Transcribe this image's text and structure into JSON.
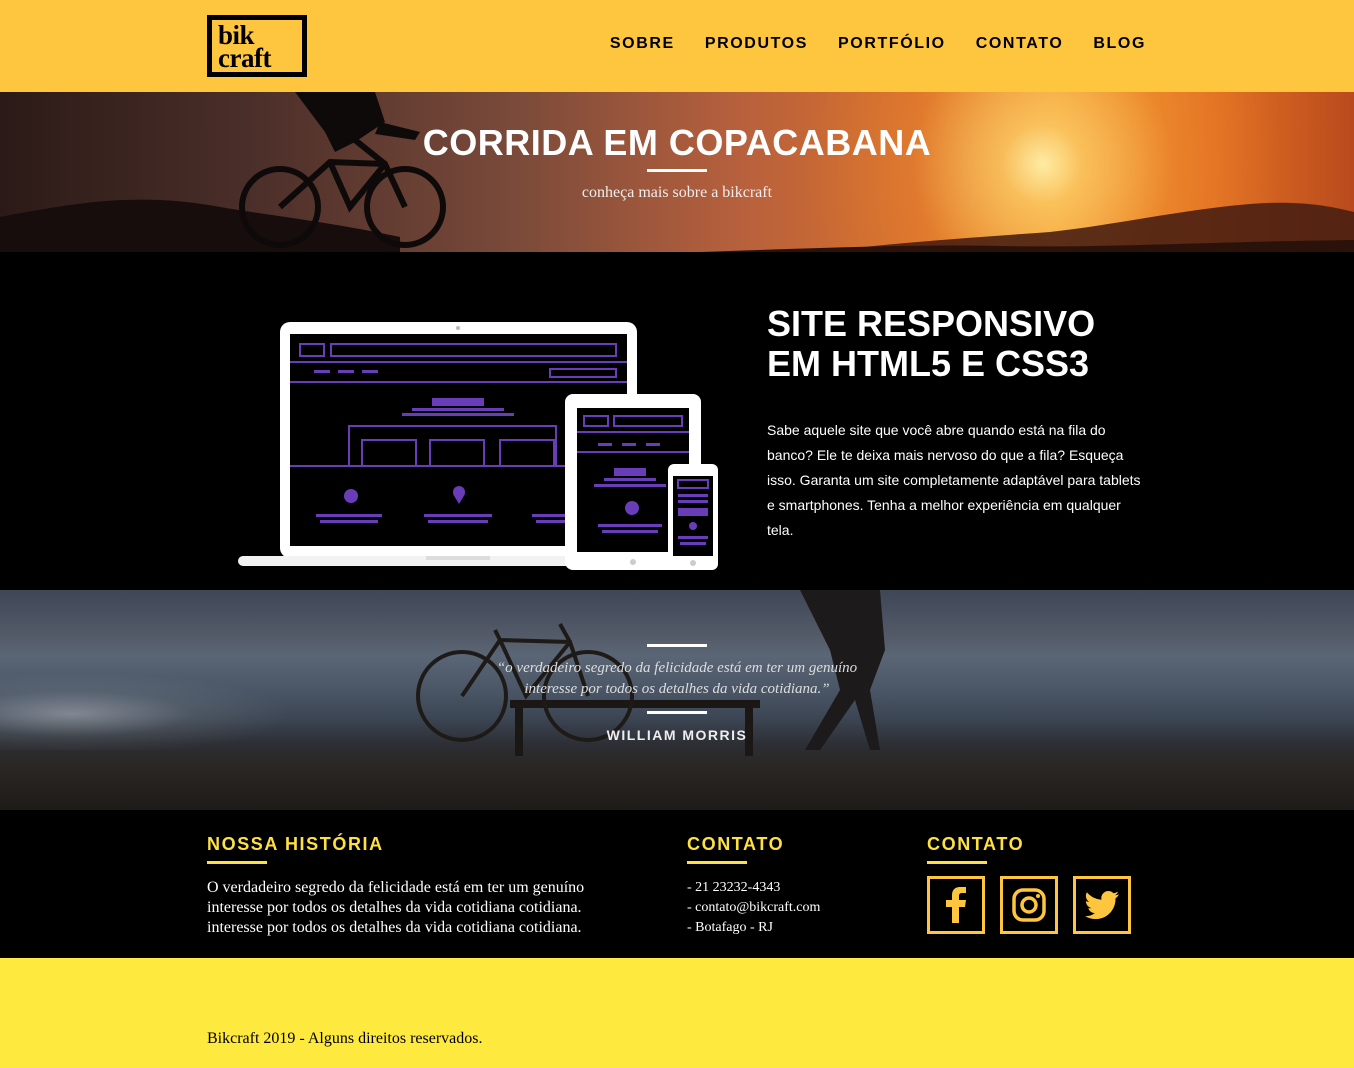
{
  "header": {
    "logo_line1": "bik",
    "logo_line2": "craft",
    "nav": [
      "SOBRE",
      "PRODUTOS",
      "PORTFÓLIO",
      "CONTATO",
      "BLOG"
    ]
  },
  "hero": {
    "title": "CORRIDA EM COPACABANA",
    "subtitle": "conheça mais sobre a bikcraft"
  },
  "responsive": {
    "title_line1": "SITE RESPONSIVO",
    "title_line2": "EM HTML5 E CSS3",
    "text": "Sabe aquele site que você abre quando está na fila do banco? Ele te deixa mais nervoso do que a fila? Esqueça isso. Garanta um site completamente adaptável para tablets e smartphones. Tenha a melhor experiência em qualquer tela."
  },
  "quote": {
    "text": "“o verdadeiro segredo da felicidade está em ter um genuíno interesse por todos os detalhes da vida cotidiana.”",
    "author": "WILLIAM MORRIS"
  },
  "footer": {
    "history_title": "NOSSA HISTÓRIA",
    "history_text": "O verdadeiro segredo da felicidade está em ter um genuíno interesse por todos os detalhes da vida cotidiana cotidiana. interesse por todos os detalhes da vida cotidiana cotidiana.",
    "contact_title": "CONTATO",
    "contact_items": [
      "- 21 23232-4343",
      "- contato@bikcraft.com",
      "- Botafago - RJ"
    ],
    "social_title": "CONTATO",
    "social": [
      "facebook-icon",
      "instagram-icon",
      "twitter-icon"
    ]
  },
  "copyright": "Bikcraft 2019 - Alguns direitos reservados.",
  "colors": {
    "header_bg": "#FEC63E",
    "footer_accent": "#FEE141",
    "bottom_bg": "#FEE93E",
    "device_purple": "#6A3DB8"
  }
}
